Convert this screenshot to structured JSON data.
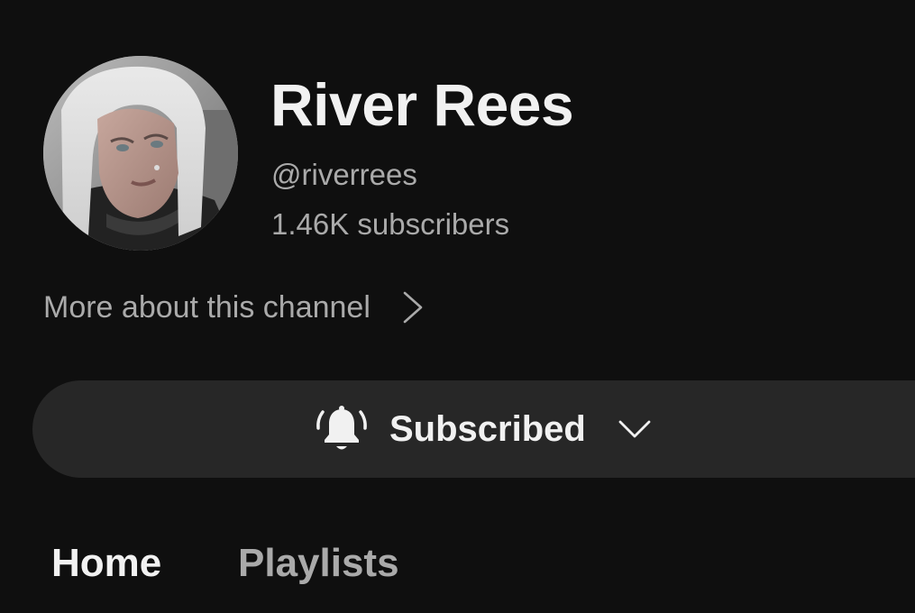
{
  "channel": {
    "name": "River Rees",
    "handle": "@riverrees",
    "subscribers": "1.46K subscribers",
    "avatar_icon": "channel-avatar"
  },
  "about_link": {
    "label": "More about this channel",
    "icon": "chevron-right-icon"
  },
  "subscribe_button": {
    "label": "Subscribed",
    "state": "subscribed",
    "icons": [
      "bell-icon",
      "chevron-down-icon"
    ]
  },
  "tabs": [
    {
      "label": "Home",
      "active": true
    },
    {
      "label": "Playlists",
      "active": false
    }
  ],
  "colors": {
    "background": "#0f0f0f",
    "primary_text": "#f1f1f1",
    "secondary_text": "#aaaaaa",
    "button_bg": "#272727"
  }
}
